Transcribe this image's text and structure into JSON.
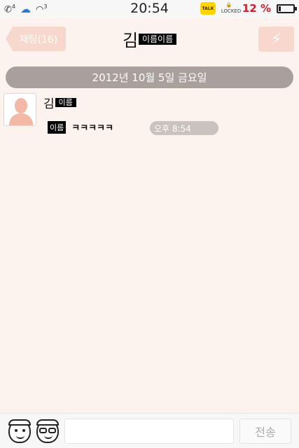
{
  "status_bar": {
    "time": "20:54",
    "call_badge": "4",
    "wifi_badge": "3",
    "talk_label": "TALK",
    "lock_label": "LOCKED",
    "battery_percent": "12 %",
    "battery_level": 0.12
  },
  "header": {
    "back_label": "채팅(16)",
    "title_prefix": "김",
    "title_redacted": "이름이름",
    "menu_icon": "lightning-icon"
  },
  "chat": {
    "date_separator": "2012년 10월 5일 금요일",
    "messages": [
      {
        "sender_prefix": "김",
        "sender_redacted": "이름",
        "text_redacted": "이름",
        "text": "ㅋㅋㅋㅋㅋ",
        "time": "오후 8:54"
      }
    ]
  },
  "composer": {
    "input_value": "",
    "send_label": "전송",
    "emoticon_icons": [
      "emoticon-cap-icon",
      "emoticon-glasses-icon"
    ]
  },
  "colors": {
    "background": "#fdf3ee",
    "button_pink": "#f8d7cc",
    "date_bar": "#a99f9c",
    "battery_red": "#d0202a",
    "talk_yellow": "#ffd400"
  }
}
